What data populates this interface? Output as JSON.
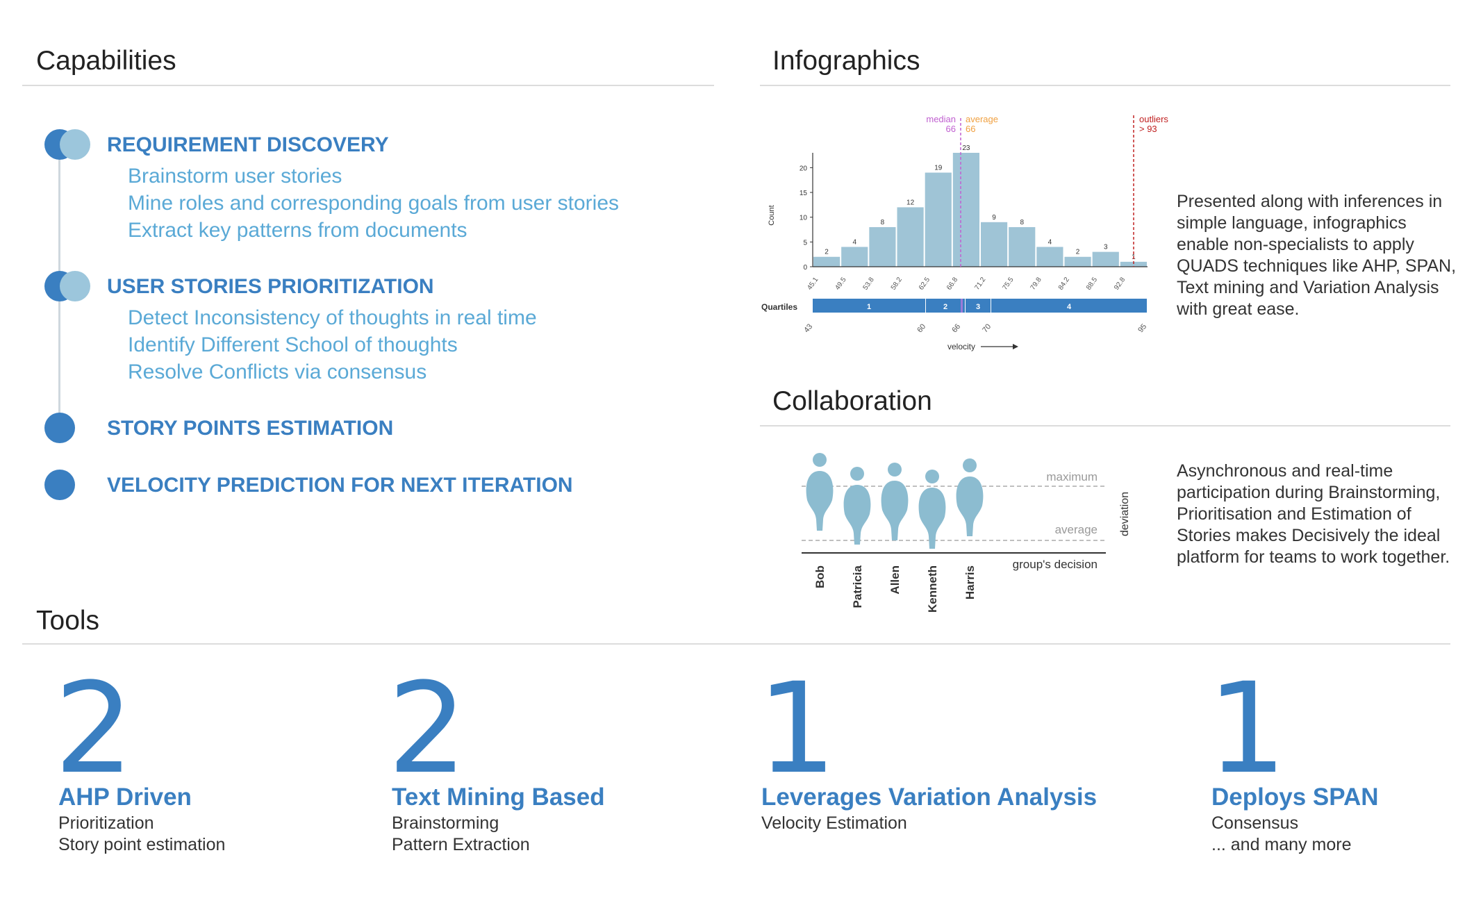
{
  "capabilities": {
    "title": "Capabilities",
    "items": [
      {
        "title": "REQUIREMENT DISCOVERY",
        "subs": [
          "Brainstorm user stories",
          "Mine roles and corresponding goals from user stories",
          "Extract key patterns from documents"
        ]
      },
      {
        "title": "USER STORIES PRIORITIZATION",
        "subs": [
          "Detect Inconsistency of thoughts in real time",
          "Identify Different School of thoughts",
          "Resolve Conflicts via consensus"
        ]
      },
      {
        "title": "STORY POINTS ESTIMATION",
        "subs": []
      },
      {
        "title": "VELOCITY PREDICTION FOR NEXT ITERATION",
        "subs": []
      }
    ]
  },
  "infographics": {
    "title": "Infographics",
    "description": "Presented along with inferences in simple language, infographics enable non-specialists to apply QUADS techniques like AHP, SPAN, Text mining and Variation Analysis with great ease.",
    "median_label": "median",
    "median_value": "66",
    "average_label": "average",
    "average_value": "66",
    "outliers_label": "outliers",
    "outliers_value": "> 93",
    "quartiles_label": "Quartiles",
    "quartile_names": [
      "1",
      "2",
      "3",
      "4"
    ],
    "quartile_ticks": [
      "43",
      "60",
      "66",
      "70",
      "95"
    ],
    "xlabel": "velocity",
    "ylabel": "Count"
  },
  "chart_data": {
    "type": "bar",
    "categories": [
      "45.1",
      "49.5",
      "53.8",
      "58.2",
      "62.5",
      "66.8",
      "71.2",
      "75.5",
      "79.8",
      "84.2",
      "88.5",
      "92.8"
    ],
    "values": [
      2,
      4,
      8,
      12,
      19,
      23,
      9,
      8,
      4,
      2,
      3,
      1
    ],
    "yticks": [
      0,
      5,
      10,
      15,
      20
    ],
    "ylim": [
      0,
      23
    ],
    "xlabel": "velocity",
    "ylabel": "Count",
    "grid": false
  },
  "collaboration": {
    "title": "Collaboration",
    "description": "Asynchronous and real-time participation during Brainstorming, Prioritisation and Estimation of Stories makes Decisively the ideal platform for teams to work together.",
    "people": [
      "Bob",
      "Patricia",
      "Allen",
      "Kenneth",
      "Harris"
    ],
    "maximum_label": "maximum",
    "average_label": "average",
    "deviation_label": "deviation",
    "decision_label": "group's decision"
  },
  "tools": {
    "title": "Tools",
    "items": [
      {
        "number": "2",
        "title": "AHP Driven",
        "lines": [
          "Prioritization",
          "Story point estimation"
        ]
      },
      {
        "number": "2",
        "title": "Text Mining Based",
        "lines": [
          "Brainstorming",
          "Pattern Extraction"
        ]
      },
      {
        "number": "1",
        "title": "Leverages Variation Analysis",
        "lines": [
          "Velocity Estimation"
        ]
      },
      {
        "number": "1",
        "title": "Deploys SPAN",
        "lines": [
          "Consensus",
          "... and many more"
        ]
      }
    ]
  },
  "colors": {
    "accent": "#3a7fc1",
    "accent_light": "#5aa9d6",
    "bar": "#9fc4d6",
    "median": "#c060d0",
    "average": "#f0a040",
    "outliers": "#c02020",
    "person": "#8cbcd0"
  }
}
